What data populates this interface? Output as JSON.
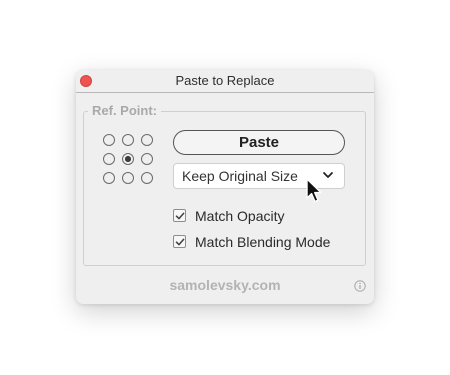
{
  "window": {
    "title": "Paste to Replace",
    "close_icon": "close-icon",
    "close_color": "#ef5350"
  },
  "ref_point": {
    "label": "Ref. Point:",
    "selected": "center"
  },
  "paste_button": {
    "label": "Paste"
  },
  "size_dropdown": {
    "selected": "Keep Original Size",
    "icon": "chevron-down-icon"
  },
  "options": {
    "match_opacity": {
      "label": "Match Opacity",
      "checked": true
    },
    "match_blending": {
      "label": "Match Blending Mode",
      "checked": true
    }
  },
  "footer": {
    "text": "samolevsky.com",
    "info_icon": "info-icon"
  },
  "cursor": "arrow-cursor-icon"
}
